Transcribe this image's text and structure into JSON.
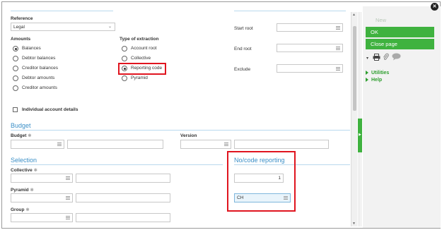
{
  "close": {
    "glyph": "✕"
  },
  "reference": {
    "label": "Reference",
    "value": "Legal"
  },
  "amounts": {
    "label": "Amounts",
    "options": [
      "Balances",
      "Debtor balances",
      "Creditor balances",
      "Debtor amounts",
      "Creditor amounts"
    ],
    "selected": "Balances"
  },
  "type_of_extraction": {
    "label": "Type of extraction",
    "options": [
      "Account root",
      "Collective",
      "Reporting code",
      "Pyramid"
    ],
    "selected": "Reporting code"
  },
  "roots": {
    "start_root": "Start root",
    "end_root": "End root",
    "exclude": "Exclude"
  },
  "individual_details": {
    "label": "Individual account details"
  },
  "budget_section": {
    "title": "Budget",
    "budget_label": "Budget",
    "version_label": "Version"
  },
  "selection_section": {
    "title": "Selection",
    "collective_label": "Collective",
    "pyramid_label": "Pyramid",
    "group_label": "Group"
  },
  "reporting_section": {
    "title": "No/code reporting",
    "number_value": "1",
    "code_value": "CH"
  },
  "side_panel": {
    "new_label": "New",
    "ok_label": "OK",
    "close_page_label": "Close page",
    "utilities_label": "Utilities",
    "help_label": "Help"
  },
  "colors": {
    "accent": "#3fb23f",
    "section": "#3a8fc7",
    "highlight": "#e0151f"
  }
}
